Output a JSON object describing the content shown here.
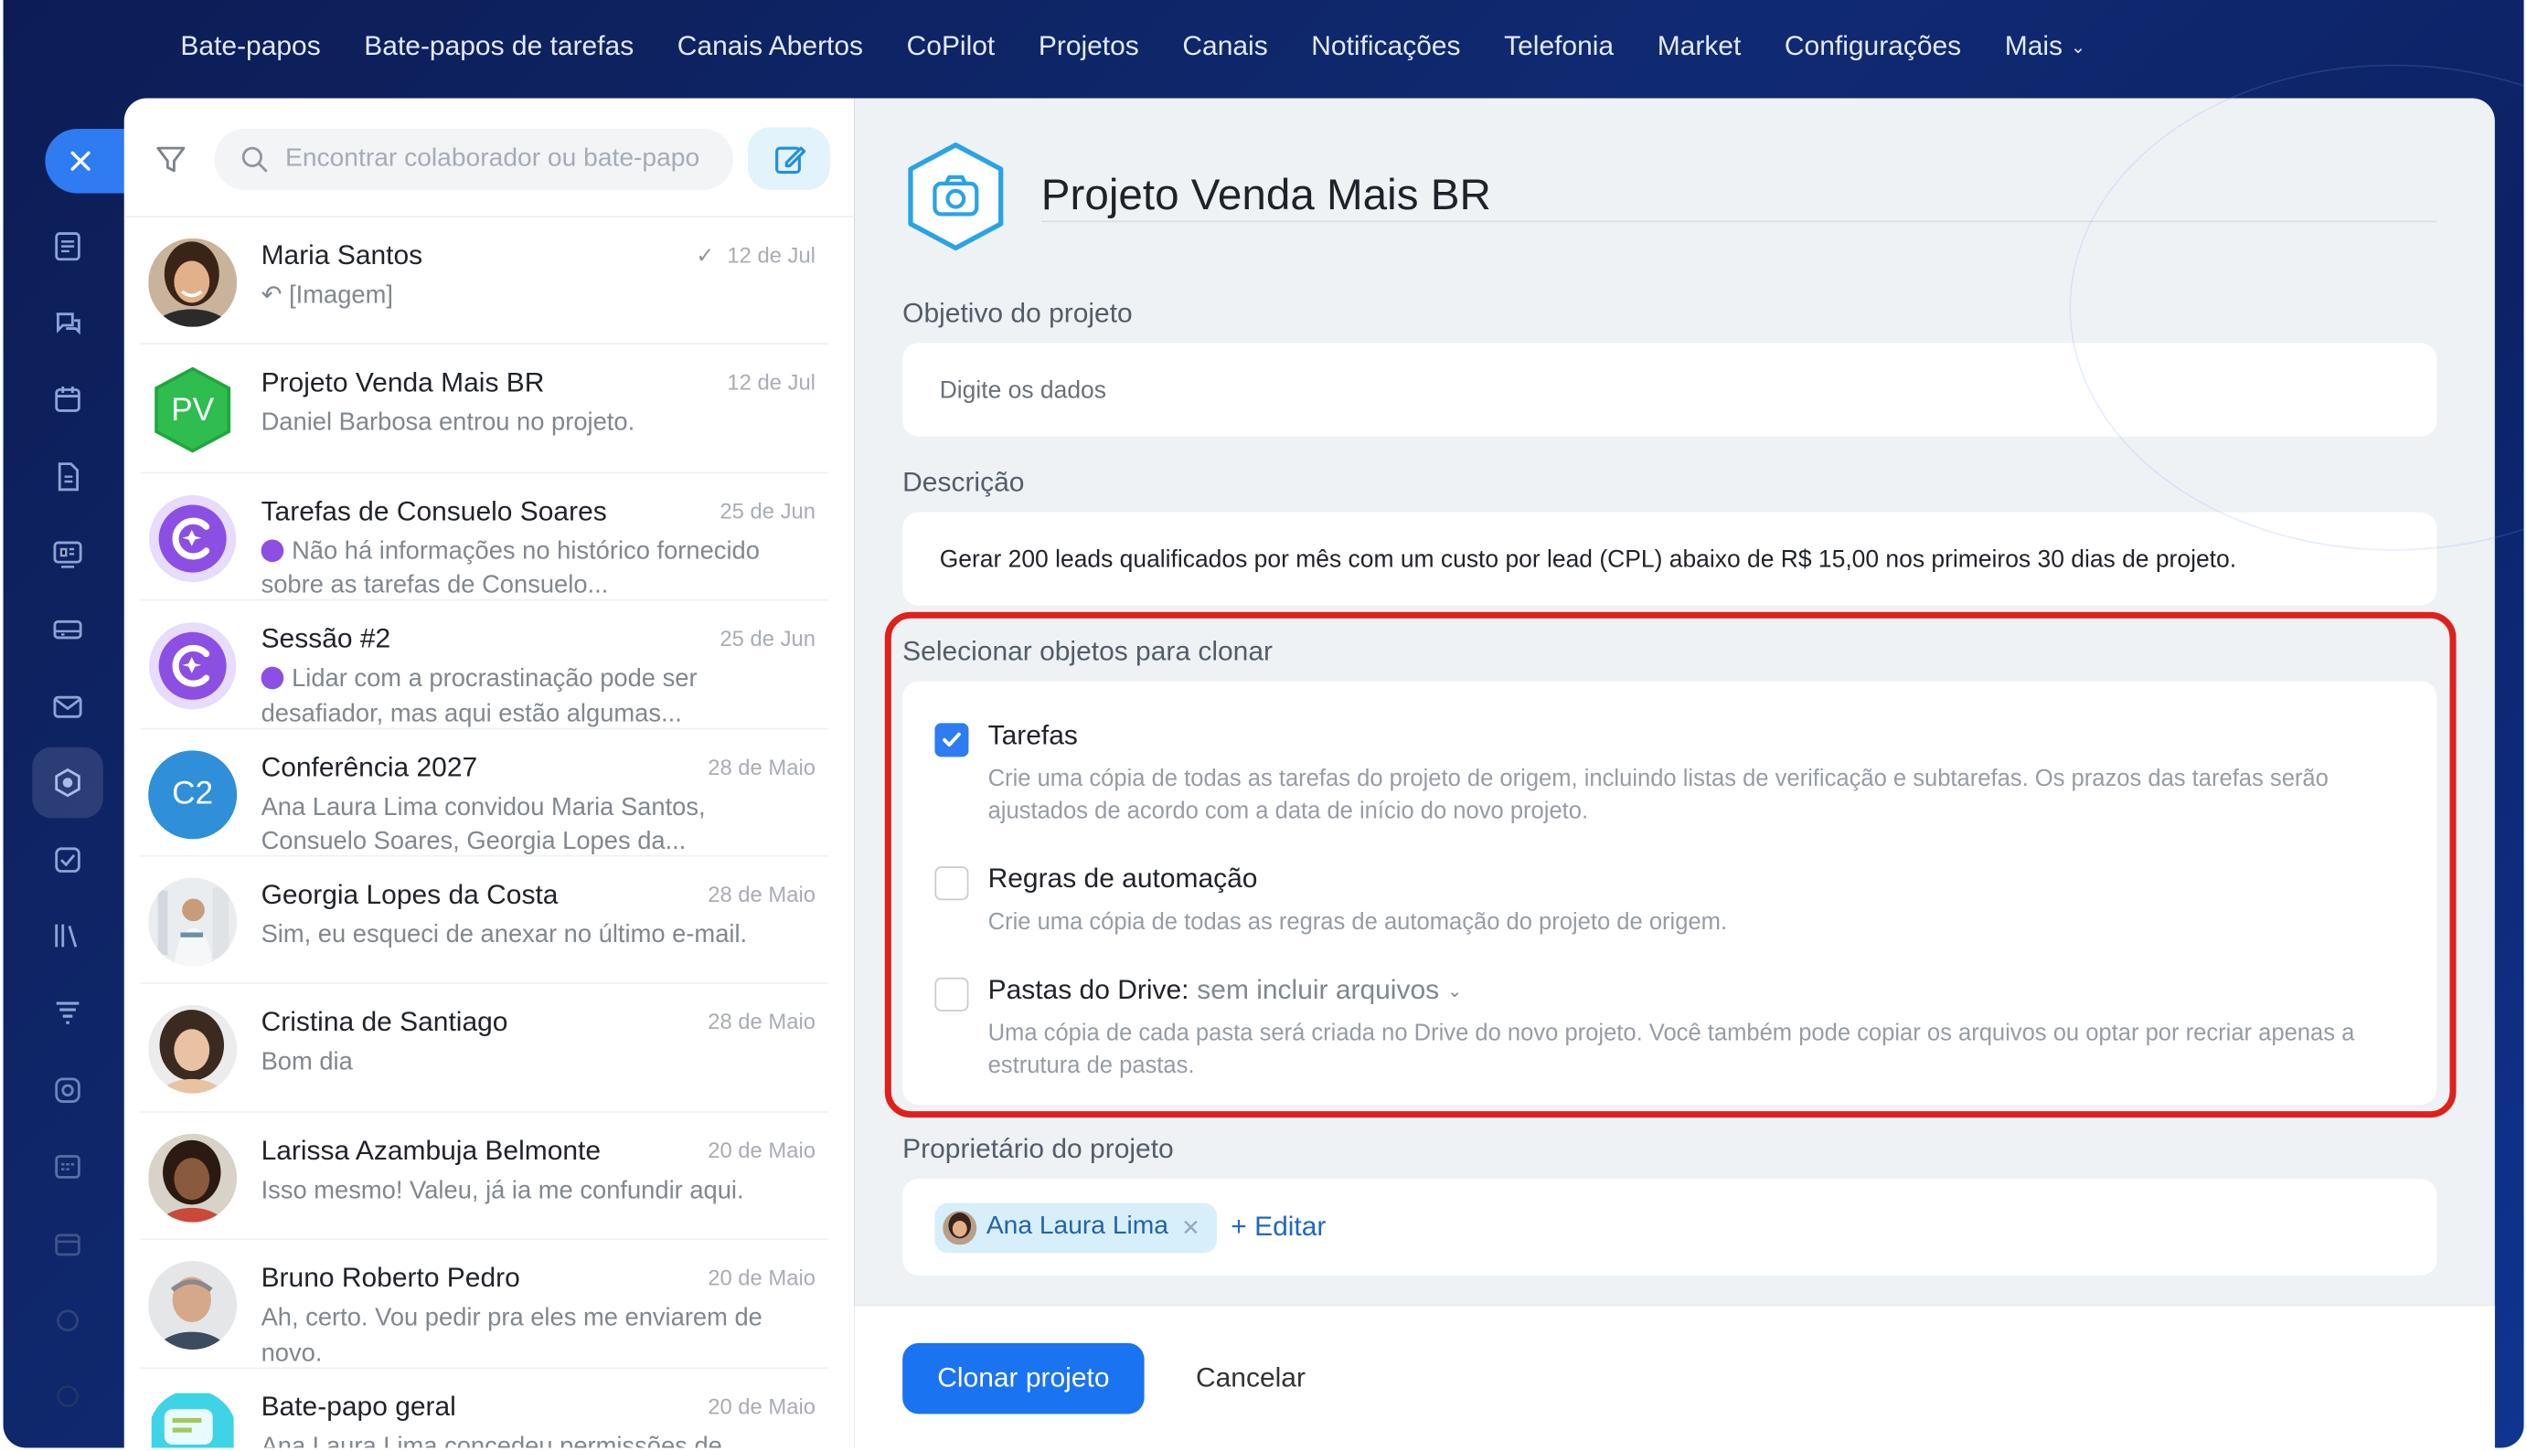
{
  "topnav": {
    "items": [
      "Bate-papos",
      "Bate-papos de tarefas",
      "Canais Abertos",
      "CoPilot",
      "Projetos",
      "Canais",
      "Notificações",
      "Telefonia",
      "Market",
      "Configurações",
      "Mais"
    ]
  },
  "chat_panel": {
    "search_placeholder": "Encontrar colaborador ou bate-papo",
    "chats": [
      {
        "title": "Maria Santos",
        "date": "12 de Jul",
        "preview": "[Imagem]",
        "avatar": "photo-woman",
        "read": true,
        "reply": true
      },
      {
        "title": "Projeto Venda Mais BR",
        "date": "12 de Jul",
        "preview": "Daniel Barbosa entrou no projeto.",
        "avatar_text": "PV",
        "avatar_color": "#2ebd4e"
      },
      {
        "title": "Tarefas de Consuelo Soares",
        "date": "25 de Jun",
        "preview": "Não há informações no histórico fornecido sobre as tarefas de Consuelo...",
        "avatar": "copilot-icon"
      },
      {
        "title": "Sessão #2",
        "date": "25 de Jun",
        "preview": "Lidar com a procrastinação pode ser desafiador, mas aqui estão algumas...",
        "avatar": "copilot-icon"
      },
      {
        "title": "Conferência 2027",
        "date": "28 de Maio",
        "preview": "Ana Laura Lima convidou Maria Santos, Consuelo Soares, Georgia Lopes da...",
        "avatar_text": "C2",
        "avatar_color": "#2f8fd8"
      },
      {
        "title": "Georgia Lopes da Costa",
        "date": "28 de Maio",
        "preview": "Sim, eu esqueci de anexar no último e-mail.",
        "avatar": "photo-woman-office"
      },
      {
        "title": "Cristina de Santiago",
        "date": "28 de Maio",
        "preview": "Bom dia",
        "avatar": "photo-woman-curly"
      },
      {
        "title": "Larissa Azambuja Belmonte",
        "date": "20 de Maio",
        "preview": "Isso mesmo! Valeu, já ia me confundir aqui.",
        "avatar": "photo-woman-dark"
      },
      {
        "title": "Bruno Roberto Pedro",
        "date": "20 de Maio",
        "preview": "Ah, certo. Vou pedir pra eles me enviarem de novo.",
        "avatar": "photo-man"
      },
      {
        "title": "Bate-papo geral",
        "date": "20 de Maio",
        "preview": "Ana Laura Lima concedeu permissões de",
        "avatar": "general-chat-icon"
      }
    ]
  },
  "form": {
    "project_title": "Projeto Venda Mais BR",
    "objective_label": "Objetivo do projeto",
    "objective_placeholder": "Digite os dados",
    "description_label": "Descrição",
    "description_value": "Gerar 200 leads qualificados por mês com um custo por lead (CPL) abaixo de R$ 15,00 nos primeiros 30 dias de projeto.",
    "clone_label": "Selecionar objetos para clonar",
    "clone_options": [
      {
        "title": "Tarefas",
        "checked": true,
        "desc": "Crie uma cópia de todas as tarefas do projeto de origem, incluindo listas de verificação e subtarefas. Os prazos das tarefas serão ajustados de acordo com a data de início do novo projeto."
      },
      {
        "title": "Regras de automação",
        "checked": false,
        "desc": "Crie uma cópia de todas as regras de automação do projeto de origem."
      },
      {
        "title": "Pastas do Drive:",
        "subtitle": "sem incluir arquivos",
        "checked": false,
        "desc": "Uma cópia de cada pasta será criada no Drive do novo projeto. Você também pode copiar os arquivos ou optar por recriar apenas a estrutura de pastas."
      }
    ],
    "owner_label": "Proprietário do projeto",
    "owner_name": "Ana Laura Lima",
    "edit_label": "+ Editar",
    "clone_button": "Clonar projeto",
    "cancel_button": "Cancelar"
  },
  "colors": {
    "accent": "#1a73f0",
    "highlight": "#e0201b",
    "nav_bg": "#0c1d55"
  }
}
